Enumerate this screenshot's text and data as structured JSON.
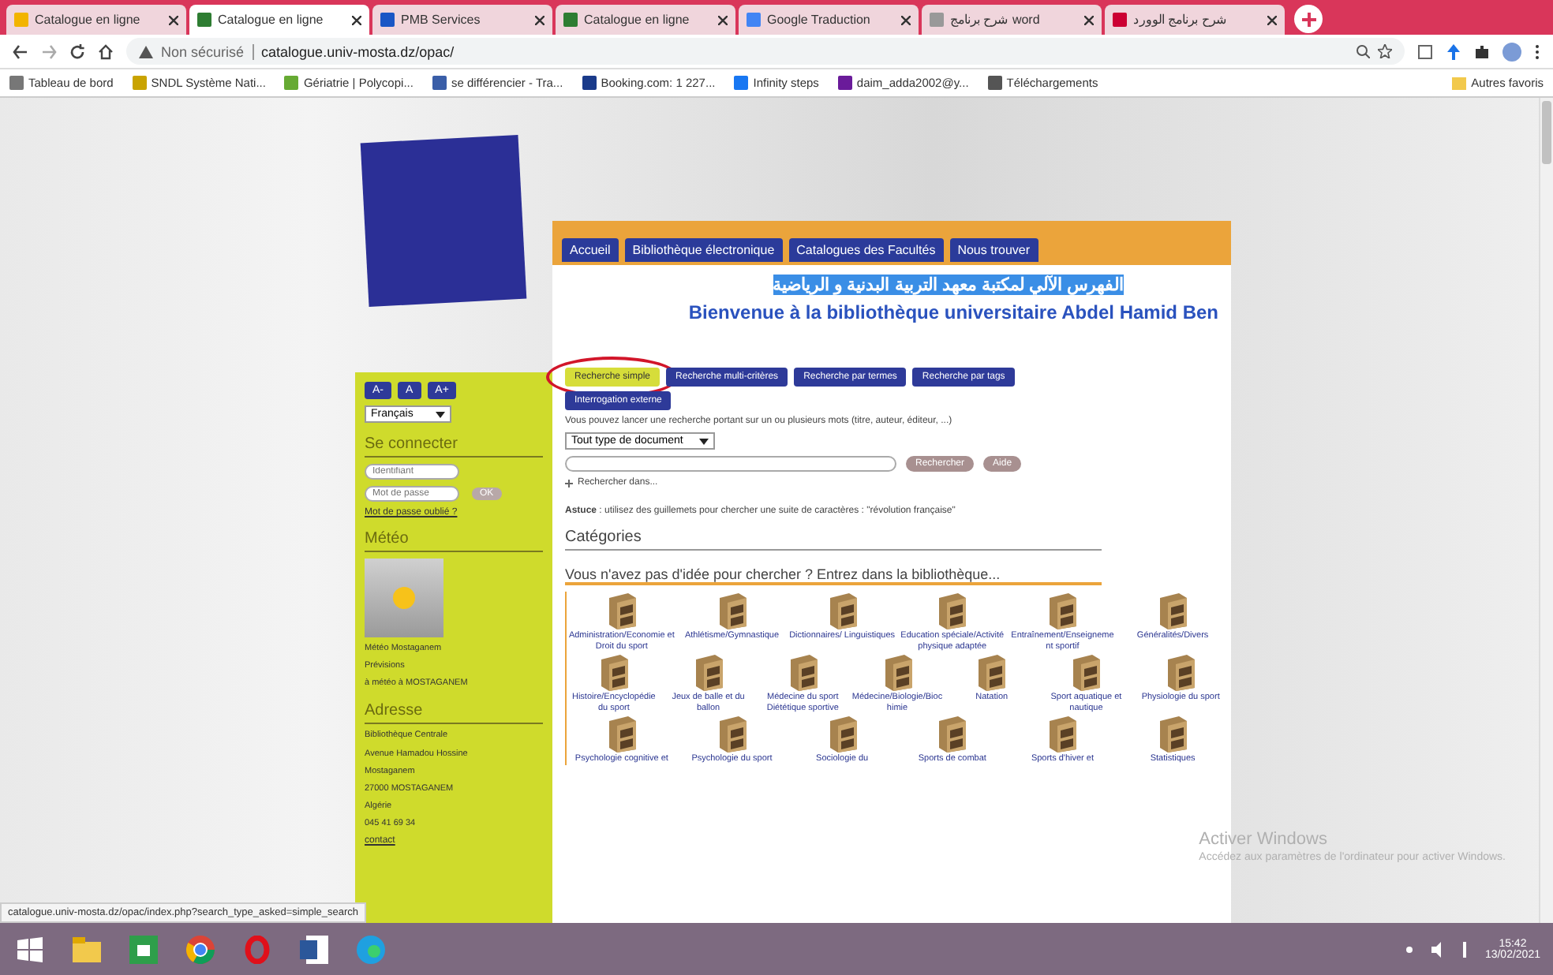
{
  "browser_tabs": [
    {
      "title": "Catalogue en ligne",
      "selected": false
    },
    {
      "title": "Catalogue en ligne",
      "selected": true
    },
    {
      "title": "PMB Services",
      "selected": false
    },
    {
      "title": "Catalogue en ligne",
      "selected": false
    },
    {
      "title": "Google Traduction",
      "selected": false
    },
    {
      "title": "شرح برنامج word",
      "selected": false
    },
    {
      "title": "شرح برنامج الوورد",
      "selected": false
    }
  ],
  "address_bar": {
    "security": "Non sécurisé",
    "url": "catalogue.univ-mosta.dz/opac/"
  },
  "bookmarks": [
    "Tableau de bord",
    "SNDL Système Nati...",
    "Gériatrie | Polycopi...",
    "se différencier - Tra...",
    "Booking.com: 1 227...",
    "Infinity steps",
    "daim_adda2002@y...",
    "Téléchargements"
  ],
  "other_bookmarks": "Autres favoris",
  "site": {
    "nav": [
      "Accueil",
      "Bibliothèque électronique",
      "Catalogues des Facultés",
      "Nous trouver"
    ],
    "arabic_title": "الفهرس الآلي لمكتبة معهد التربية البدنية و الرياضية",
    "welcome": "Bienvenue à la bibliothèque universitaire Abdel Hamid Ben",
    "font_buttons": [
      "A-",
      "A",
      "A+"
    ],
    "language": "Français",
    "login": {
      "heading": "Se connecter",
      "user_placeholder": "Identifiant",
      "password_placeholder": "Mot de passe",
      "submit": "OK",
      "forgot": "Mot de passe oublié ?"
    },
    "weather": {
      "heading": "Météo",
      "lines": [
        "Météo Mostaganem",
        "Prévisions",
        "à météo à MOSTAGANEM"
      ]
    },
    "address": {
      "heading": "Adresse",
      "lines": [
        "Bibliothèque Centrale",
        "Avenue Hamadou Hossine",
        "Mostaganem",
        "27000 MOSTAGANEM",
        "Algérie",
        "045 41 69 34"
      ],
      "link": "contact"
    },
    "search_tabs": [
      {
        "label": "Recherche simple",
        "selected": true,
        "circled": true
      },
      {
        "label": "Recherche multi-critères",
        "selected": false,
        "circled": false
      },
      {
        "label": "Recherche par termes",
        "selected": false,
        "circled": false
      },
      {
        "label": "Recherche par tags",
        "selected": false,
        "circled": false
      },
      {
        "label": "Interrogation externe",
        "selected": false,
        "circled": false
      }
    ],
    "hint": "Vous pouvez lancer une recherche portant sur un ou plusieurs mots (titre, auteur, éditeur, ...)",
    "doc_type": "Tout type de document",
    "search_button": "Rechercher",
    "help_button": "Aide",
    "search_in": "Rechercher dans...",
    "tip": "**Astuce** : utilisez des guillemets pour chercher une suite de caractères : \"révolution française\"",
    "categories_heading": "Catégories",
    "browse_prompt": "Vous n'avez pas d'idée pour chercher ? Entrez dans la bibliothèque...",
    "categories": [
      [
        "Administration/Economie et Droit du sport",
        "Athlétisme/Gymnastique",
        "Dictionnaires/ Linguistiques",
        "Education spéciale/Activité physique adaptée",
        "Entraînement/Enseignement sportif",
        "Généralités/Divers"
      ],
      [
        "Histoire/Encyclopédie du sport",
        "Jeux de balle et du ballon",
        "Médecine du sport Diététique sportive",
        "Médecine/Biologie/Biochimie",
        "Natation",
        "Sport aquatique et nautique",
        "Physiologie du sport"
      ],
      [
        "Psychologie cognitive et",
        "Psychologie du sport",
        "Sociologie du",
        "Sports de combat",
        "Sports d'hiver et",
        "Statistiques"
      ]
    ]
  },
  "status_url": "catalogue.univ-mosta.dz/opac/index.php?search_type_asked=simple_search",
  "activation_notice": {
    "title": "Activer Windows",
    "text": "Accédez aux paramètres de l'ordinateur pour activer Windows."
  },
  "taskbar": {
    "time": "15:42",
    "date": "13/02/2021"
  }
}
